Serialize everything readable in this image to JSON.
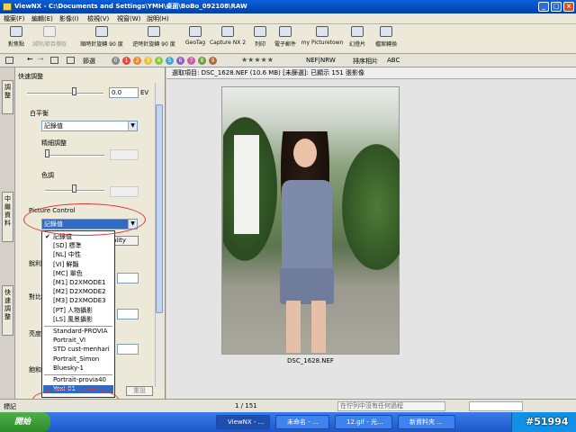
{
  "window": {
    "title": "ViewNX - C:\\Documents and Settings\\YMH\\桌面\\BoBo_092108\\RAW",
    "buttons": {
      "minimize": "_",
      "maximize": "□",
      "close": "×"
    }
  },
  "menu": [
    "檔案(F)",
    "編輯(E)",
    "影像(I)",
    "檢視(V)",
    "視窗(W)",
    "說明(H)"
  ],
  "toolbar": [
    {
      "label": "對焦點",
      "icon": "focus-point-icon",
      "enabled": true
    },
    {
      "label": "減除/節目擷取",
      "icon": "crop-icon",
      "enabled": false
    },
    {
      "label": "順時針旋轉 90 度",
      "icon": "rotate-cw-icon",
      "enabled": true
    },
    {
      "label": "逆時針旋轉 90 度",
      "icon": "rotate-ccw-icon",
      "enabled": true
    },
    {
      "label": "GeoTag",
      "icon": "geotag-icon",
      "enabled": true
    },
    {
      "label": "Capture NX 2",
      "icon": "capture-nx-icon",
      "enabled": true
    },
    {
      "label": "列印",
      "icon": "print-icon",
      "enabled": true
    },
    {
      "label": "電子郵件",
      "icon": "email-icon",
      "enabled": true
    },
    {
      "label": "my Picturetown",
      "icon": "picturetown-icon",
      "enabled": true
    },
    {
      "label": "幻燈片",
      "icon": "slideshow-icon",
      "enabled": true
    },
    {
      "label": "檔案轉換",
      "icon": "file-convert-icon",
      "enabled": true
    }
  ],
  "toolbar2": {
    "folder_label": "節選",
    "labels": [
      "0",
      "1",
      "2",
      "3",
      "4",
      "5",
      "6",
      "7",
      "8",
      "9"
    ],
    "label_colors": [
      "#888888",
      "#e84a3c",
      "#e98a2e",
      "#e8c23a",
      "#8cc540",
      "#3ea7d8",
      "#8b5cc8",
      "#c85ca8",
      "#6b9b44",
      "#aa6a3a"
    ],
    "rating": "★★★★★",
    "filter": "NEF|NRW",
    "sort_label": "排序相片",
    "view_label": "ABC"
  },
  "sidetabs": [
    "調整",
    "中繼資料",
    "快速調整"
  ],
  "panel": {
    "section_title": "快速調整",
    "exposure_value": "0.0",
    "exposure_unit": "EV",
    "white_balance_label": "白平衡",
    "white_balance_value": "記錄值",
    "fine_tune_label": "精細調整",
    "hue_label": "色調",
    "picture_control_label": "Picture Control",
    "picture_control_value": "記錄值",
    "behind_button": "ality",
    "partial_labels": [
      "銳利",
      "對比",
      "亮度",
      "飽和"
    ],
    "reset_button": "重設"
  },
  "dropdown": {
    "items": [
      {
        "text": "記錄值",
        "checked": true,
        "selected": false
      },
      {
        "text": "[SD] 標準",
        "checked": false,
        "selected": false
      },
      {
        "text": "[NL] 中性",
        "checked": false,
        "selected": false
      },
      {
        "text": "[VI] 鮮豔",
        "checked": false,
        "selected": false
      },
      {
        "text": "[MC] 單色",
        "checked": false,
        "selected": false
      },
      {
        "text": "[M1] D2XMODE1",
        "checked": false,
        "selected": false
      },
      {
        "text": "[M2] D2XMODE2",
        "checked": false,
        "selected": false
      },
      {
        "text": "[M3] D2XMODE3",
        "checked": false,
        "selected": false
      },
      {
        "text": "[PT] 人物攝影",
        "checked": false,
        "selected": false
      },
      {
        "text": "[LS] 風景攝影",
        "checked": false,
        "selected": false
      },
      {
        "text": "Standard-PROVIA",
        "checked": false,
        "selected": false
      },
      {
        "text": "Portrait_VI",
        "checked": false,
        "selected": false
      },
      {
        "text": "STD cust-menhari",
        "checked": false,
        "selected": false
      },
      {
        "text": "Portrait_Simon",
        "checked": false,
        "selected": false
      },
      {
        "text": "Bluesky-1",
        "checked": false,
        "selected": false
      },
      {
        "text": "Portrait-provia40",
        "checked": false,
        "selected": false
      },
      {
        "text": "Yoxi-01",
        "checked": false,
        "selected": true
      }
    ]
  },
  "main": {
    "header": "選取項目: DSC_1628.NEF (10.6 MB) [未篩選]: 已顯示 151 張影像",
    "photo_caption": "DSC_1628.NEF"
  },
  "bottom": {
    "left_label": "標記",
    "page_counter": "1 / 151",
    "status_text": "在佇列中沒有任何過程"
  },
  "taskbar": {
    "start": "開始",
    "tasks": [
      "ViewNX - ...",
      "未命名 - ...",
      "12.gif - 光...",
      "新資料夾 ..."
    ],
    "watermark": "#51994"
  }
}
